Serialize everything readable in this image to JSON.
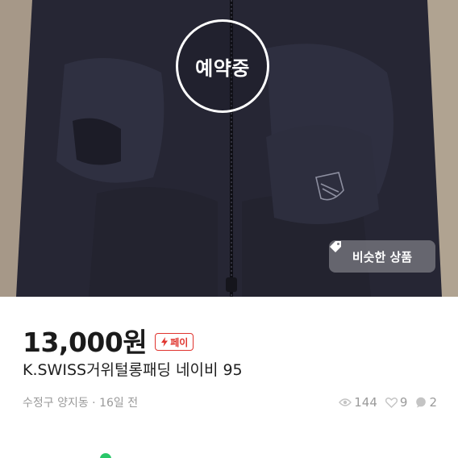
{
  "photo": {
    "reserved_label": "예약중",
    "similar_button_label": "비슷한 상품"
  },
  "listing": {
    "price": "13,000원",
    "pay_badge_label": "페이",
    "title": "K.SWISS거위털롱패딩 네이비 95",
    "location_time": "수정구 양지동 · 16일 전",
    "views": "144",
    "likes": "9",
    "chats": "2"
  },
  "colors": {
    "pay_accent": "#e0342e",
    "status_green": "#2ac769"
  },
  "icons": [
    "lightning-icon",
    "tag-icon",
    "eye-icon",
    "heart-icon",
    "chat-icon"
  ]
}
